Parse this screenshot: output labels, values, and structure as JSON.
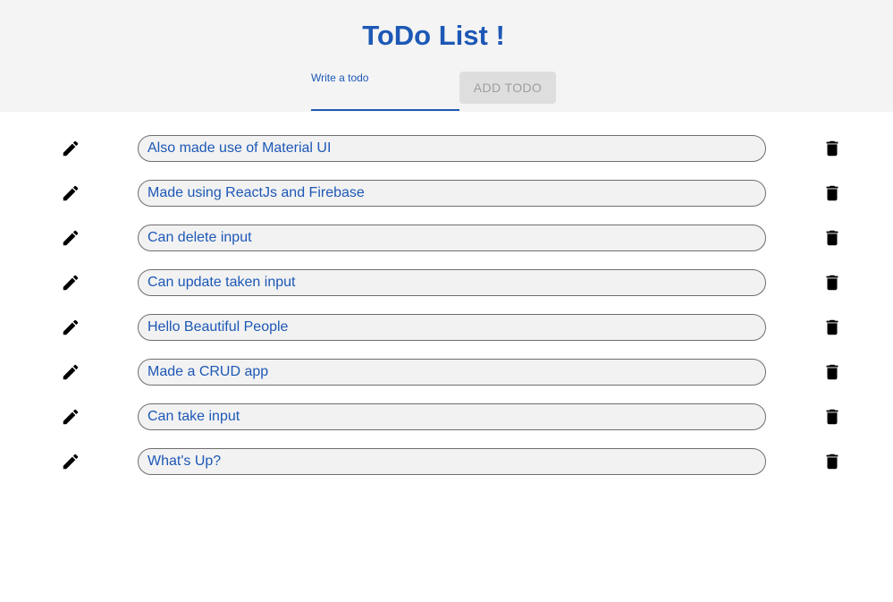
{
  "header": {
    "title": "ToDo List !",
    "input_label": "Write a todo",
    "input_value": "",
    "add_button_label": "ADD TODO"
  },
  "todos": [
    {
      "text": "Also made use of Material UI"
    },
    {
      "text": "Made using ReactJs and Firebase"
    },
    {
      "text": "Can delete input"
    },
    {
      "text": "Can update taken input"
    },
    {
      "text": "Hello Beautiful People"
    },
    {
      "text": "Made a CRUD app"
    },
    {
      "text": "Can take input"
    },
    {
      "text": "What's Up?"
    }
  ],
  "icons": {
    "edit": "pencil-icon",
    "delete": "trash-icon"
  },
  "colors": {
    "accent": "#1d58b6",
    "header_bg": "#f4f4f4",
    "button_disabled_bg": "#dedede",
    "button_disabled_text": "#9e9e9e"
  }
}
